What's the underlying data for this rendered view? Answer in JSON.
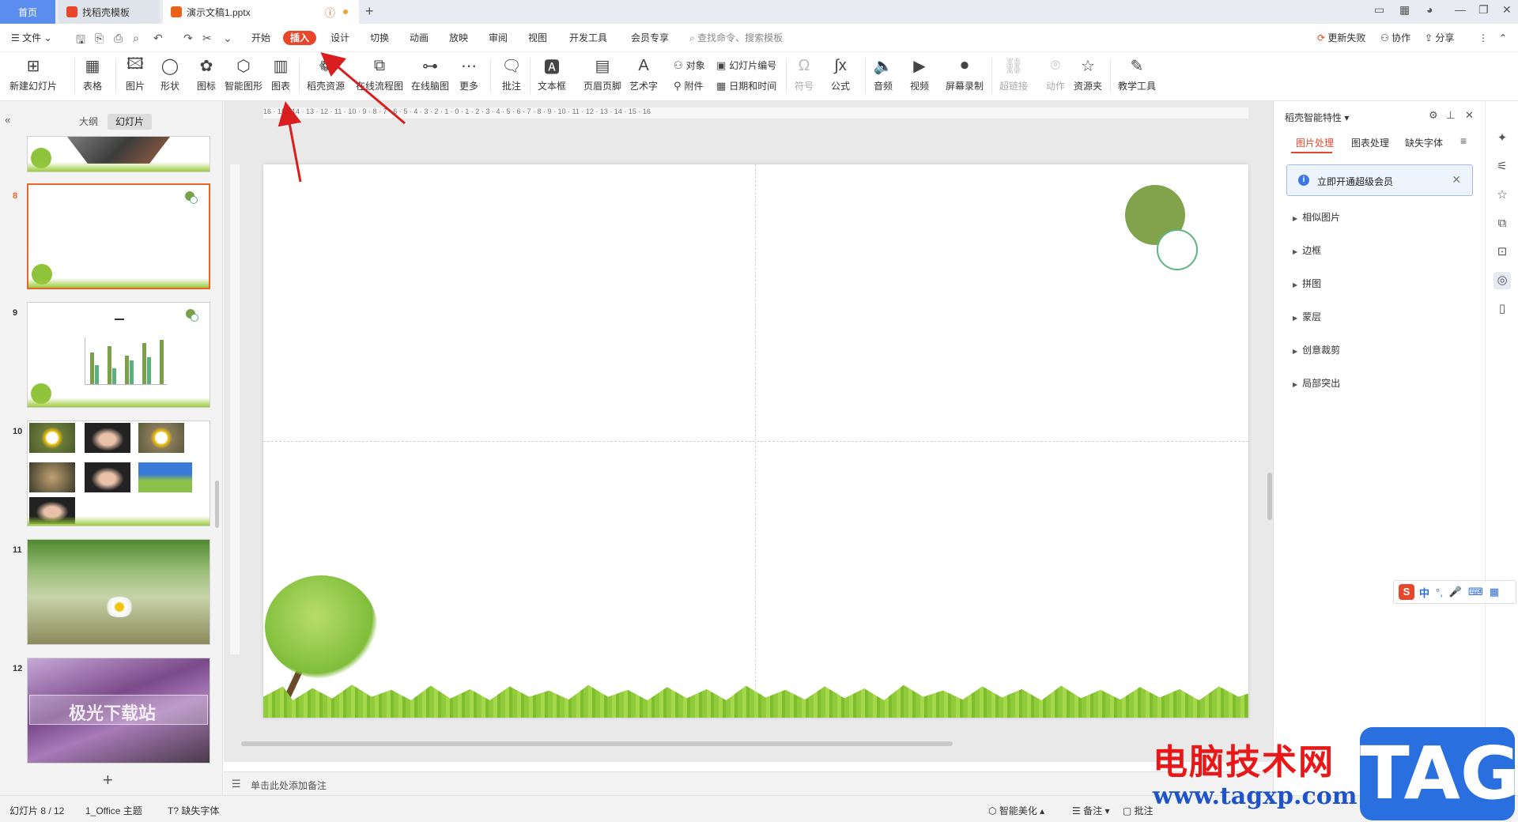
{
  "titlebar": {
    "home_tab": "首页",
    "tab1": "找稻壳模板",
    "tab2": "演示文稿1.pptx",
    "new_tab": "+"
  },
  "menubar": {
    "file": "文件",
    "items": [
      "开始",
      "插入",
      "设计",
      "切换",
      "动画",
      "放映",
      "审阅",
      "视图",
      "开发工具",
      "会员专享"
    ],
    "active": "插入",
    "search_placeholder": "查找命令、搜索模板",
    "update_failed": "更新失败",
    "collaborate": "协作",
    "share": "分享"
  },
  "ribbon": {
    "new_slide": "新建幻灯片",
    "table": "表格",
    "picture": "图片",
    "shape": "形状",
    "icon": "图标",
    "smart_shape": "智能图形",
    "chart": "图表",
    "docer_resources": "稻壳资源",
    "online_flowchart": "在线流程图",
    "online_mindmap": "在线脑图",
    "more": "更多",
    "comment": "批注",
    "textbox": "文本框",
    "header_footer": "页眉页脚",
    "wordart": "艺术字",
    "object": "对象",
    "slide_number": "幻灯片编号",
    "attachment": "附件",
    "date_time": "日期和时间",
    "symbol": "符号",
    "formula": "公式",
    "audio": "音频",
    "video": "视频",
    "screen_record": "屏幕录制",
    "hyperlink": "超链接",
    "action": "动作",
    "resource_folder": "资源夹",
    "teaching_tools": "教学工具"
  },
  "leftpanel": {
    "tab_outline": "大纲",
    "tab_slides": "幻灯片",
    "slide_numbers": [
      "8",
      "9",
      "10",
      "11",
      "12"
    ],
    "selected_slide": "8",
    "slide12_text": "极光下载站"
  },
  "ruler": {
    "labels": "16 · 15 · 14 · 13 · 12 · 11 · 10 · 9 · 8 · 7 · 6 · 5 · 4 · 3 · 2 · 1 · 0 · 1 · 2 · 3 · 4 · 5 · 6 · 7 · 8 · 9 · 10 · 11 · 12 · 13 · 14 · 15 · 16"
  },
  "notes": {
    "placeholder": "单击此处添加备注"
  },
  "rightpanel": {
    "title": "稻壳智能特性",
    "tabs": [
      "图片处理",
      "图表处理",
      "缺失字体"
    ],
    "active_tab": "图片处理",
    "banner": "立即开通超级会员",
    "items": [
      "相似图片",
      "边框",
      "拼图",
      "蒙层",
      "创意裁剪",
      "局部突出"
    ]
  },
  "ime": {
    "logo": "S",
    "mode": "中"
  },
  "statusbar": {
    "slide_counter": "幻灯片 8 / 12",
    "theme": "1_Office 主题",
    "missing_font": "缺失字体",
    "smart_beautify": "智能美化",
    "notes": "备注",
    "comment": "批注"
  },
  "watermark": {
    "cn": "电脑技术网",
    "url": "www.tagxp.com",
    "tag": "TAG"
  },
  "colors": {
    "accent": "#e8462c",
    "selection": "#e8662c",
    "annotation_arrow": "#d81e1e"
  }
}
